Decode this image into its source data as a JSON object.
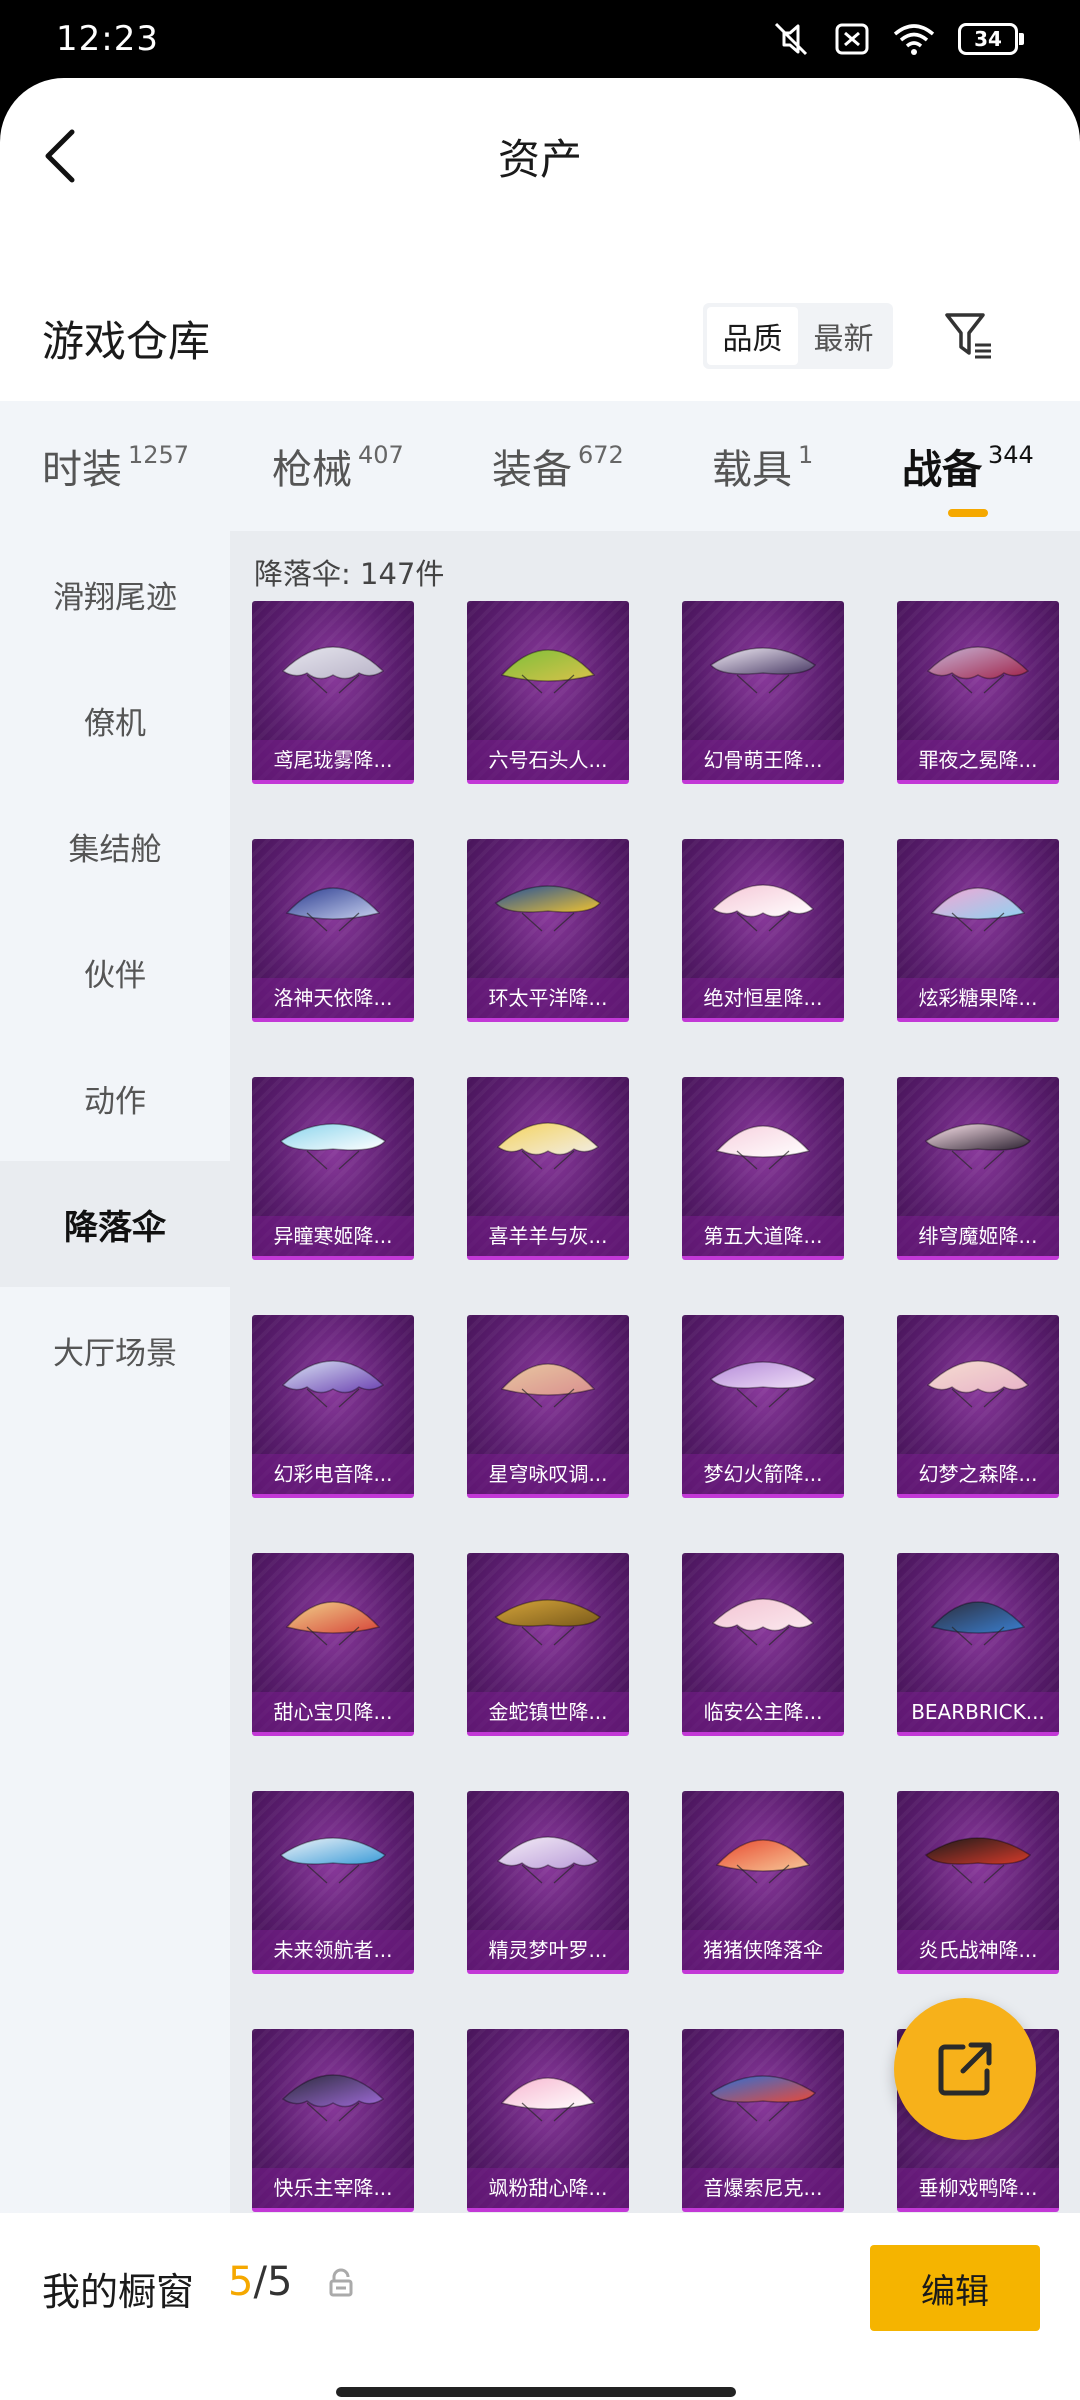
{
  "status_bar": {
    "time": "12:23",
    "battery": "34"
  },
  "nav": {
    "title": "资产"
  },
  "warehouse": {
    "title": "游戏仓库"
  },
  "sort": {
    "options": [
      "品质",
      "最新"
    ],
    "active": 0
  },
  "categories": [
    {
      "label": "时装",
      "count": "1257"
    },
    {
      "label": "枪械",
      "count": "407"
    },
    {
      "label": "装备",
      "count": "672"
    },
    {
      "label": "载具",
      "count": "1"
    },
    {
      "label": "战备",
      "count": "344"
    }
  ],
  "active_category": 4,
  "sidebar": {
    "items": [
      "滑翔尾迹",
      "僚机",
      "集结舱",
      "伙伴",
      "动作",
      "降落伞",
      "大厅场景"
    ],
    "active": 5
  },
  "content": {
    "header": "降落伞: 147件"
  },
  "items": [
    {
      "name": "鸢尾珑雾降...",
      "c1": "#e6e6ee",
      "c2": "#b9b3c8"
    },
    {
      "name": "六号石头人...",
      "c1": "#7dbf3a",
      "c2": "#d9c24a"
    },
    {
      "name": "幻骨萌王降...",
      "c1": "#f1ecf5",
      "c2": "#4a3a66"
    },
    {
      "name": "罪夜之冕降...",
      "c1": "#c8b6d8",
      "c2": "#a0234a"
    },
    {
      "name": "洛神天依降...",
      "c1": "#2a3b8f",
      "c2": "#c9d2f0"
    },
    {
      "name": "环太平洋降...",
      "c1": "#1f4e9c",
      "c2": "#f0c330"
    },
    {
      "name": "绝对恒星降...",
      "c1": "#f5c6d6",
      "c2": "#ffffff"
    },
    {
      "name": "炫彩糖果降...",
      "c1": "#f3a6d4",
      "c2": "#8fd3f0"
    },
    {
      "name": "异瞳寒姬降...",
      "c1": "#8ad4ec",
      "c2": "#ffffff"
    },
    {
      "name": "喜羊羊与灰...",
      "c1": "#f4d35c",
      "c2": "#f2ede6"
    },
    {
      "name": "第五大道降...",
      "c1": "#f7d0de",
      "c2": "#ffffff"
    },
    {
      "name": "绯穹魔姬降...",
      "c1": "#ffe6ee",
      "c2": "#2b2030"
    },
    {
      "name": "幻彩电音降...",
      "c1": "#d9e4f5",
      "c2": "#6a3fb0"
    },
    {
      "name": "星穹咏叹调...",
      "c1": "#e8c7a0",
      "c2": "#d98f8f"
    },
    {
      "name": "梦幻火箭降...",
      "c1": "#b48ad8",
      "c2": "#f0e0f8"
    },
    {
      "name": "幻梦之森降...",
      "c1": "#f6ddd0",
      "c2": "#e7b2c8"
    },
    {
      "name": "甜心宝贝降...",
      "c1": "#f1d28a",
      "c2": "#d6453a"
    },
    {
      "name": "金蛇镇世降...",
      "c1": "#d4a43a",
      "c2": "#7a5a1a"
    },
    {
      "name": "临安公主降...",
      "c1": "#f3c4d3",
      "c2": "#fbe9ef"
    },
    {
      "name": "BEARBRICK...",
      "c1": "#2c2c3a",
      "c2": "#3a7fd1"
    },
    {
      "name": "未来领航者...",
      "c1": "#f0f4f8",
      "c2": "#3a9bd8"
    },
    {
      "name": "精灵梦叶罗...",
      "c1": "#f5eef7",
      "c2": "#b89ad8"
    },
    {
      "name": "猪猪侠降落伞",
      "c1": "#e84a2f",
      "c2": "#f7c99a"
    },
    {
      "name": "炎氏战神降...",
      "c1": "#1a1a1a",
      "c2": "#d63a2a"
    },
    {
      "name": "快乐主宰降...",
      "c1": "#2a2a3a",
      "c2": "#9f6ad8"
    },
    {
      "name": "飒粉甜心降...",
      "c1": "#f7b5cf",
      "c2": "#ffffff"
    },
    {
      "name": "音爆索尼克...",
      "c1": "#2b6fd6",
      "c2": "#e84a3a"
    },
    {
      "name": "垂柳戏鸭降...",
      "c1": "#7a4a2a",
      "c2": "#e8c07a"
    }
  ],
  "showcase": {
    "label": "我的橱窗",
    "current": "5",
    "separator": "/",
    "total": "5"
  },
  "edit_button": {
    "label": "编辑"
  }
}
